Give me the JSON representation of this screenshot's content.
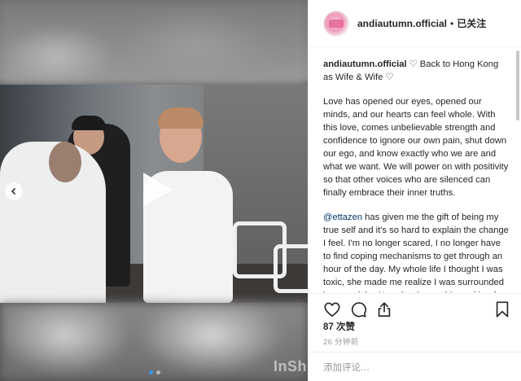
{
  "post": {
    "username": "andiautumn.official",
    "separator": "•",
    "follow_status": "已关注",
    "caption_title": "♡ Back to Hong Kong as Wife & Wife ♡",
    "paragraph_1": "Love has opened our eyes, opened our minds, and our hearts can feel whole. With this love, comes unbelievable strength and confidence to ignore our own pain, shut down our ego, and know exactly who we are and what we want. We will power on with positivity so that other voices who are silenced can finally embrace their inner truths.",
    "mention": "@ettazen",
    "paragraph_2": " has given me the gift of being my true self and it's so hard to explain the change I feel. I'm no longer scared, I no longer have to find coping mechanisms to get through an hour of the day. My whole life I thought I was toxic, she made me realize I was surrounded by negativity. Now that it was this seeking for love that...",
    "likes": "87 次赞",
    "time_ago": "26 分钟前",
    "comment_placeholder": "添加评论..."
  },
  "media": {
    "watermark": "InSh",
    "carousel_total": 2,
    "carousel_active": 0
  },
  "icons": {
    "play": "play-icon",
    "prev": "chevron-left-icon",
    "like": "heart-icon",
    "comment": "comment-icon",
    "share": "share-icon",
    "save": "bookmark-icon"
  },
  "colors": {
    "link": "#003569",
    "active_dot": "#3897f0",
    "text": "#262626",
    "muted": "#999999"
  }
}
